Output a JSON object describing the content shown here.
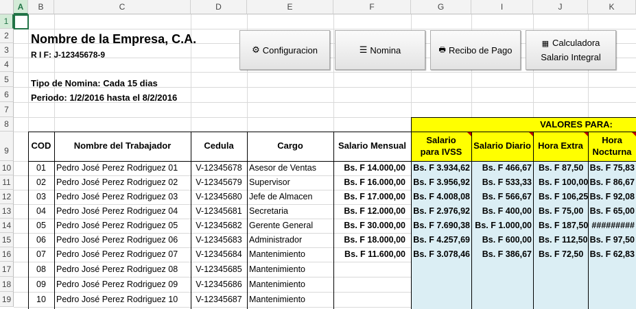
{
  "sheet": {
    "columns": [
      "A",
      "B",
      "C",
      "D",
      "E",
      "F",
      "G",
      "I",
      "J",
      "K"
    ],
    "rows": [
      "1",
      "2",
      "3",
      "4",
      "5",
      "6",
      "7",
      "8",
      "9",
      "10",
      "11",
      "12",
      "13",
      "14",
      "15",
      "16",
      "17",
      "18",
      "19"
    ],
    "company_name": "Nombre de la Empresa, C.A.",
    "rif": "R I F:  J-12345678-9",
    "tipo_nomina": "Tipo de Nomina: Cada 15 dias",
    "periodo": "Periodo:  1/2/2016 hasta el 8/2/2016"
  },
  "buttons": {
    "config": {
      "icon": "⚙",
      "label": "Configuracion"
    },
    "nomina": {
      "icon": "☰",
      "label": "Nomina"
    },
    "recibo": {
      "icon": "🖶",
      "label": "Recibo de Pago"
    },
    "calc": {
      "icon": "▦",
      "label1": "Calculadora",
      "label2": "Salario Integral"
    }
  },
  "table": {
    "valores_para": "VALORES PARA:",
    "headers": {
      "cod": "COD",
      "nombre": "Nombre del Trabajador",
      "cedula": "Cedula",
      "cargo": "Cargo",
      "salario_mensual": "Salario Mensual",
      "ivss": "Salario para IVSS",
      "diario": "Salario Diario",
      "hora_extra": "Hora Extra",
      "hora_nocturna": "Hora Nocturna"
    },
    "rows": [
      {
        "cod": "01",
        "nombre": "Pedro José Perez Rodriguez 01",
        "cedula": "V-12345678",
        "cargo": "Asesor de Ventas",
        "mensual": "Bs. F 14.000,00",
        "ivss": "Bs. F 3.934,62",
        "diario": "Bs. F 466,67",
        "extra": "Bs. F 87,50",
        "nocturna": "Bs. F 75,83"
      },
      {
        "cod": "02",
        "nombre": "Pedro José Perez Rodriguez 02",
        "cedula": "V-12345679",
        "cargo": "Supervisor",
        "mensual": "Bs. F 16.000,00",
        "ivss": "Bs. F 3.956,92",
        "diario": "Bs. F 533,33",
        "extra": "Bs. F 100,00",
        "nocturna": "Bs. F 86,67"
      },
      {
        "cod": "03",
        "nombre": "Pedro José Perez Rodriguez 03",
        "cedula": "V-12345680",
        "cargo": "Jefe de Almacen",
        "mensual": "Bs. F 17.000,00",
        "ivss": "Bs. F 4.008,08",
        "diario": "Bs. F 566,67",
        "extra": "Bs. F 106,25",
        "nocturna": "Bs. F 92,08"
      },
      {
        "cod": "04",
        "nombre": "Pedro José Perez Rodriguez 04",
        "cedula": "V-12345681",
        "cargo": "Secretaria",
        "mensual": "Bs. F 12.000,00",
        "ivss": "Bs. F 2.976,92",
        "diario": "Bs. F 400,00",
        "extra": "Bs. F 75,00",
        "nocturna": "Bs. F 65,00"
      },
      {
        "cod": "05",
        "nombre": "Pedro José Perez Rodriguez 05",
        "cedula": "V-12345682",
        "cargo": "Gerente General",
        "mensual": "Bs. F 30.000,00",
        "ivss": "Bs. F 7.690,38",
        "diario": "Bs. F 1.000,00",
        "extra": "Bs. F 187,50",
        "nocturna": "#########"
      },
      {
        "cod": "06",
        "nombre": "Pedro José Perez Rodriguez 06",
        "cedula": "V-12345683",
        "cargo": "Administrador",
        "mensual": "Bs. F 18.000,00",
        "ivss": "Bs. F 4.257,69",
        "diario": "Bs. F 600,00",
        "extra": "Bs. F 112,50",
        "nocturna": "Bs. F 97,50"
      },
      {
        "cod": "07",
        "nombre": "Pedro José Perez Rodriguez 07",
        "cedula": "V-12345684",
        "cargo": "Mantenimiento",
        "mensual": "Bs. F 11.600,00",
        "ivss": "Bs. F 3.078,46",
        "diario": "Bs. F 386,67",
        "extra": "Bs. F 72,50",
        "nocturna": "Bs. F 62,83"
      },
      {
        "cod": "08",
        "nombre": "Pedro José Perez Rodriguez 08",
        "cedula": "V-12345685",
        "cargo": "Mantenimiento",
        "mensual": "",
        "ivss": "",
        "diario": "",
        "extra": "",
        "nocturna": ""
      },
      {
        "cod": "09",
        "nombre": "Pedro José Perez Rodriguez 09",
        "cedula": "V-12345686",
        "cargo": "Mantenimiento",
        "mensual": "",
        "ivss": "",
        "diario": "",
        "extra": "",
        "nocturna": ""
      },
      {
        "cod": "10",
        "nombre": "Pedro José Perez Rodriguez 10",
        "cedula": "V-12345687",
        "cargo": "Mantenimiento",
        "mensual": "",
        "ivss": "",
        "diario": "",
        "extra": "",
        "nocturna": ""
      }
    ]
  },
  "colors": {
    "yellow": "#ffff00",
    "lightblue": "#dbeef4",
    "header_green": "#217346"
  }
}
